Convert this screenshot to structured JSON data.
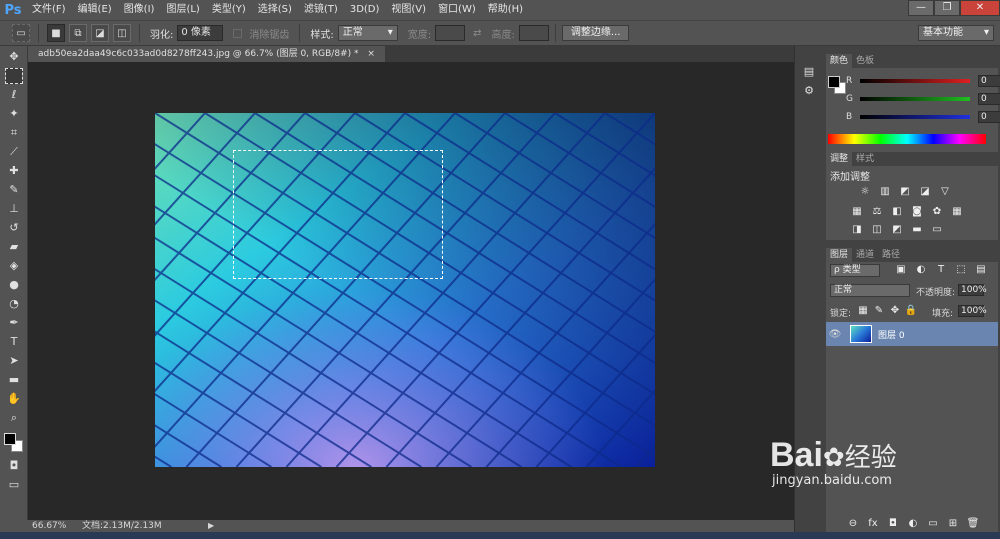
{
  "app": {
    "logo": "Ps"
  },
  "menu": [
    "文件(F)",
    "编辑(E)",
    "图像(I)",
    "图层(L)",
    "类型(Y)",
    "选择(S)",
    "滤镜(T)",
    "3D(D)",
    "视图(V)",
    "窗口(W)",
    "帮助(H)"
  ],
  "window_controls": {
    "minimize": "—",
    "restore": "❐",
    "close": "✕"
  },
  "options": {
    "feather_label": "羽化:",
    "feather_value": "0 像素",
    "antialias_label": "消除锯齿",
    "style_label": "样式:",
    "style_value": "正常",
    "width_label": "宽度:",
    "height_label": "高度:",
    "refine_button": "调整边缘...",
    "workspace_value": "基本功能"
  },
  "document": {
    "tab_title": "adb50ea2daa49c6c033ad0d8278ff243.jpg @ 66.7% (图层 0, RGB/8#) *",
    "tab_close": "×"
  },
  "status": {
    "zoom": "66.67%",
    "doc_info": "文档:2.13M/2.13M"
  },
  "color_panel": {
    "tabs": [
      "颜色",
      "色板"
    ],
    "sliders": [
      {
        "label": "R",
        "value": "0",
        "track": "#c82020"
      },
      {
        "label": "G",
        "value": "0",
        "track": "#20a020"
      },
      {
        "label": "B",
        "value": "0",
        "track": "#2030c8"
      }
    ]
  },
  "adjust_panel": {
    "tabs": [
      "调整",
      "样式"
    ],
    "heading": "添加调整",
    "row1": [
      "☼",
      "▥",
      "◩",
      "◪",
      "▽"
    ],
    "row2": [
      "▦",
      "⚖",
      "◧",
      "◙",
      "✿",
      "▦"
    ],
    "row3": [
      "◨",
      "◫",
      "◩",
      "▬",
      "▭"
    ]
  },
  "layers_panel": {
    "tabs": [
      "图层",
      "通道",
      "路径"
    ],
    "filter_value": "ρ 类型",
    "blend_value": "正常",
    "opacity_label": "不透明度:",
    "opacity_value": "100%",
    "lock_label": "锁定:",
    "fill_label": "填充:",
    "fill_value": "100%",
    "layers": [
      {
        "name": "图层 0",
        "visible_icon": "👁"
      }
    ],
    "footer_icons": [
      "⊖",
      "fx",
      "◘",
      "◐",
      "▭",
      "⊞",
      "🗑"
    ]
  },
  "watermark": {
    "brand": "Bai",
    "brand2": "经验",
    "url": "jingyan.baidu.com"
  },
  "colors": {
    "accent": "#4ea6ff",
    "chrome": "#535353",
    "canvas_bg": "#282828",
    "layer_selected": "#6a86b0"
  }
}
